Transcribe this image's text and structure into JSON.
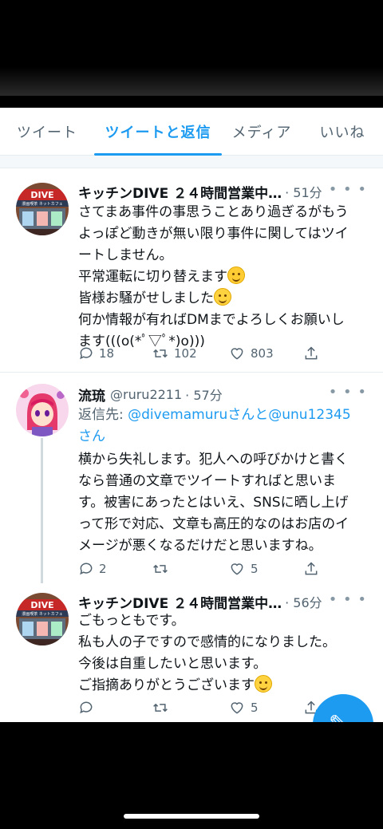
{
  "tabs": [
    {
      "label": "ツイート",
      "active": false
    },
    {
      "label": "ツイートと返信",
      "active": true
    },
    {
      "label": "メディア",
      "active": false
    },
    {
      "label": "いいね",
      "active": false
    }
  ],
  "tweets": [
    {
      "name": "キッチンDIVE ２４時間営業中…",
      "handle": "",
      "time": "· 51分",
      "lines": [
        "さてまあ事件の事思うことあり過ぎるがもう",
        "よっぽど動きが無い限り事件に関してはツイ",
        "ートしません。",
        "平常運転に切り替えます",
        "皆様お騒がせしました",
        "何か情報が有ればDMまでよろしくお願いし",
        "ます(((o(*ﾟ▽ﾟ*)o)))"
      ],
      "replies": "18",
      "retweets": "102",
      "likes": "803",
      "avatar_sign": "DIVE",
      "avatar_subtext": "漫画喫茶 ネットカフェ"
    },
    {
      "name": "流琉",
      "handle": "@ruru2211",
      "time": "· 57分",
      "reply_prefix": "返信先: ",
      "reply_user1": "@divemamuru",
      "reply_mid": "さんと",
      "reply_user2": "@unu12345",
      "reply_suffix": "さん",
      "lines": [
        "横から失礼します。犯人への呼びかけと書く",
        "なら普通の文章でツイートすればと思いま",
        "す。被害にあったとはいえ、SNSに晒し上げ",
        "って形で対応、文章も高圧的なのはお店のイ",
        "メージが悪くなるだけだと思いますね。"
      ],
      "replies": "2",
      "retweets": "",
      "likes": "5"
    },
    {
      "name": "キッチンDIVE ２４時間営業中…",
      "handle": "",
      "time": "· 56分",
      "lines": [
        "ごもっともです。",
        "私も人の子ですので感情的になりました。",
        "今後は自重したいと思います。",
        "ご指摘ありがとうございます"
      ],
      "replies": "",
      "retweets": "",
      "likes": "5",
      "avatar_sign": "DIVE",
      "avatar_subtext": "漫画喫茶 ネットカフェ"
    }
  ],
  "fab_icon": "compose-icon",
  "colors": {
    "accent": "#1d9bf0",
    "text": "#0f1419",
    "muted": "#536471"
  }
}
